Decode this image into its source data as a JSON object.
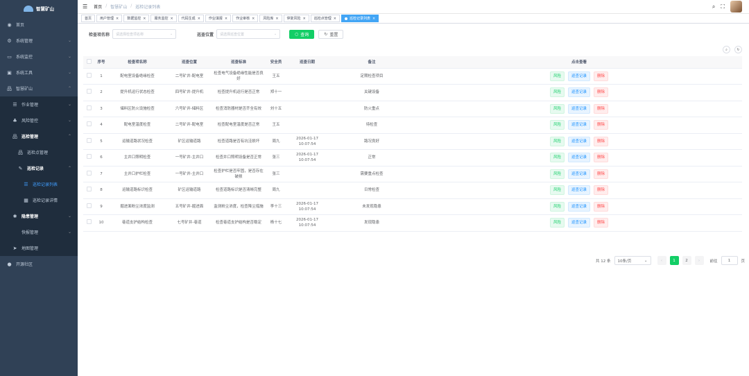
{
  "sidebar": {
    "logo_text": "智慧矿山",
    "items": [
      {
        "label": "首页",
        "icon": "dashboard-icon"
      },
      {
        "label": "系统管理",
        "icon": "gear-icon"
      },
      {
        "label": "系统监控",
        "icon": "monitor-icon"
      },
      {
        "label": "系统工具",
        "icon": "toolbox-icon"
      },
      {
        "label": "智慧矿山",
        "icon": "tree-icon"
      },
      {
        "label": "作业管理",
        "icon": "list-icon"
      },
      {
        "label": "风险管控",
        "icon": "risk-icon"
      },
      {
        "label": "巡检管理",
        "icon": "tree-icon"
      },
      {
        "label": "巡检点管理",
        "icon": "tree-icon"
      },
      {
        "label": "巡检记录",
        "icon": "edit-icon"
      },
      {
        "label": "巡检记录列表",
        "icon": "list-icon"
      },
      {
        "label": "巡检记录详情",
        "icon": "table-icon"
      },
      {
        "label": "隐患管理",
        "icon": "bug-icon"
      },
      {
        "label": "快报管理",
        "icon": ""
      },
      {
        "label": "地图管理",
        "icon": "send-icon"
      },
      {
        "label": "开源社区",
        "icon": "github-icon"
      }
    ]
  },
  "navbar": {
    "breadcrumb": [
      "首页",
      "智慧矿山",
      "巡检记录列表"
    ]
  },
  "tags": [
    "首页",
    "用户管理",
    "数据监控",
    "服务监控",
    "代码生成",
    "作业填报",
    "作业审核",
    "风险库",
    "停复风险",
    "巡检点管理",
    "巡检记录列表"
  ],
  "search": {
    "label1": "检查项名称",
    "placeholder1": "请选择检查项名称",
    "label2": "巡查位置",
    "placeholder2": "请选择巡查位置",
    "query_label": "查询",
    "reset_label": "重置"
  },
  "table": {
    "headers": [
      "序号",
      "检查项名称",
      "巡查位置",
      "巡查标准",
      "安全员",
      "巡查日期",
      "备注",
      "点击查看"
    ],
    "rows": [
      {
        "no": "1",
        "name": "配电室设备绝缘检查",
        "loc": "二号矿井-配电室",
        "std": "检查电气设备绝缘性能是否良好",
        "staff": "王五",
        "date": "",
        "note": "定期检查项目"
      },
      {
        "no": "2",
        "name": "提升机运行状态检查",
        "loc": "四号矿井-提升机",
        "std": "检查提升机运行是否正常",
        "staff": "郑十一",
        "date": "",
        "note": "关键设备"
      },
      {
        "no": "3",
        "name": "储料区防火设施检查",
        "loc": "六号矿井-储料区",
        "std": "检查消防器材是否齐全有效",
        "staff": "刘十五",
        "date": "",
        "note": "防火重点"
      },
      {
        "no": "4",
        "name": "配电室温度检查",
        "loc": "二号矿井-配电室",
        "std": "检查配电室温度是否正常",
        "staff": "王五",
        "date": "",
        "note": "待检查"
      },
      {
        "no": "5",
        "name": "运输道路状况检查",
        "loc": "矿区运输道路",
        "std": "检查道路是否有坑洼损坏",
        "staff": "周九",
        "date": "2026-01-17 10:07:54",
        "note": "路况良好"
      },
      {
        "no": "6",
        "name": "主井口照明检查",
        "loc": "一号矿井-主井口",
        "std": "检查井口照明设备是否正常",
        "staff": "张三",
        "date": "2026-01-17 10:07:54",
        "note": "正常"
      },
      {
        "no": "7",
        "name": "主井口护栏检查",
        "loc": "一号矿井-主井口",
        "std": "检查护栏是否牢固，是否存在破损",
        "staff": "张三",
        "date": "",
        "note": "需要重点检查"
      },
      {
        "no": "8",
        "name": "运输道路标识检查",
        "loc": "矿区运输道路",
        "std": "检查道路标识是否清晰完整",
        "staff": "周九",
        "date": "",
        "note": "日常检查"
      },
      {
        "no": "9",
        "name": "掘进面粉尘浓度监测",
        "loc": "五号矿井-掘进面",
        "std": "监测粉尘浓度，检查降尘措施",
        "staff": "李十三",
        "date": "2026-01-17 10:07:54",
        "note": "未发现隐患"
      },
      {
        "no": "10",
        "name": "巷道支护结构检查",
        "loc": "七号矿井-巷道",
        "std": "检查巷道支护结构是否稳定",
        "staff": "杨十七",
        "date": "2026-01-17 10:07:54",
        "note": "发现隐患"
      }
    ],
    "actions": {
      "risk": "风险",
      "record": "巡查记录",
      "delete": "删除"
    }
  },
  "pagination": {
    "total_prefix": "共 12 条",
    "page_size": "10条/页",
    "pages": [
      "1",
      "2"
    ],
    "goto_label": "前往",
    "goto_value": "1",
    "page_suffix": "页"
  }
}
